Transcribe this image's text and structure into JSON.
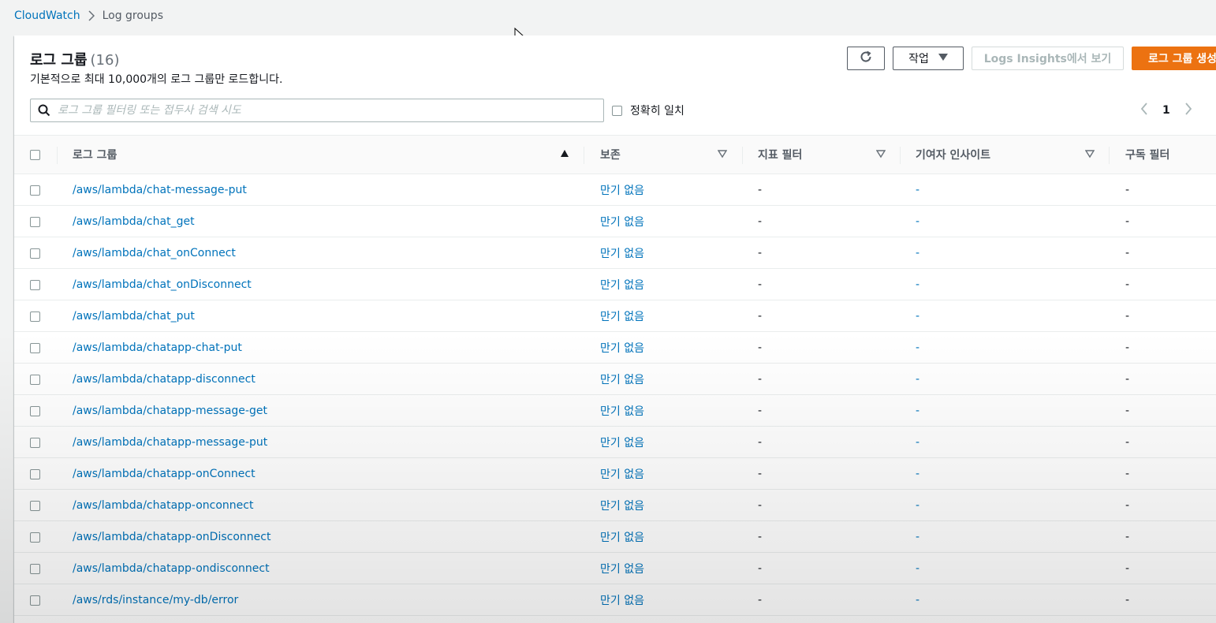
{
  "breadcrumb": {
    "root": "CloudWatch",
    "current": "Log groups"
  },
  "panel": {
    "title": "로그 그룹",
    "count": "(16)",
    "description": "기본적으로 최대 10,000개의 로그 그룹만 로드합니다."
  },
  "toolbar": {
    "actions_label": "작업",
    "insights_label": "Logs Insights에서 보기",
    "create_label": "로그 그룹 생성"
  },
  "filter": {
    "placeholder": "로그 그룹 필터링 또는 접두사 검색 시도",
    "exact_match_label": "정확히 일치"
  },
  "pagination": {
    "current_page": "1"
  },
  "table": {
    "columns": {
      "name": "로그 그룹",
      "retention": "보존",
      "metric_filters": "지표 필터",
      "contributor_insights": "기여자 인사이트",
      "subscription_filters": "구독 필터"
    },
    "rows": [
      {
        "name": "/aws/lambda/chat-message-put",
        "retention": "만기 없음",
        "metric": "-",
        "contrib": "-",
        "sub": "-"
      },
      {
        "name": "/aws/lambda/chat_get",
        "retention": "만기 없음",
        "metric": "-",
        "contrib": "-",
        "sub": "-"
      },
      {
        "name": "/aws/lambda/chat_onConnect",
        "retention": "만기 없음",
        "metric": "-",
        "contrib": "-",
        "sub": "-"
      },
      {
        "name": "/aws/lambda/chat_onDisconnect",
        "retention": "만기 없음",
        "metric": "-",
        "contrib": "-",
        "sub": "-"
      },
      {
        "name": "/aws/lambda/chat_put",
        "retention": "만기 없음",
        "metric": "-",
        "contrib": "-",
        "sub": "-"
      },
      {
        "name": "/aws/lambda/chatapp-chat-put",
        "retention": "만기 없음",
        "metric": "-",
        "contrib": "-",
        "sub": "-"
      },
      {
        "name": "/aws/lambda/chatapp-disconnect",
        "retention": "만기 없음",
        "metric": "-",
        "contrib": "-",
        "sub": "-"
      },
      {
        "name": "/aws/lambda/chatapp-message-get",
        "retention": "만기 없음",
        "metric": "-",
        "contrib": "-",
        "sub": "-"
      },
      {
        "name": "/aws/lambda/chatapp-message-put",
        "retention": "만기 없음",
        "metric": "-",
        "contrib": "-",
        "sub": "-"
      },
      {
        "name": "/aws/lambda/chatapp-onConnect",
        "retention": "만기 없음",
        "metric": "-",
        "contrib": "-",
        "sub": "-"
      },
      {
        "name": "/aws/lambda/chatapp-onconnect",
        "retention": "만기 없음",
        "metric": "-",
        "contrib": "-",
        "sub": "-"
      },
      {
        "name": "/aws/lambda/chatapp-onDisconnect",
        "retention": "만기 없음",
        "metric": "-",
        "contrib": "-",
        "sub": "-"
      },
      {
        "name": "/aws/lambda/chatapp-ondisconnect",
        "retention": "만기 없음",
        "metric": "-",
        "contrib": "-",
        "sub": "-"
      },
      {
        "name": "/aws/rds/instance/my-db/error",
        "retention": "만기 없음",
        "metric": "-",
        "contrib": "-",
        "sub": "-"
      }
    ]
  },
  "colors": {
    "link": "#0073bb",
    "primary_button": "#ec7211",
    "background": "#f2f3f3"
  },
  "icons": [
    "chevron-right-icon",
    "refresh-icon",
    "caret-down-icon",
    "search-icon",
    "chevron-left-icon",
    "sort-ascending-icon",
    "sort-icon",
    "mouse-cursor-icon"
  ]
}
